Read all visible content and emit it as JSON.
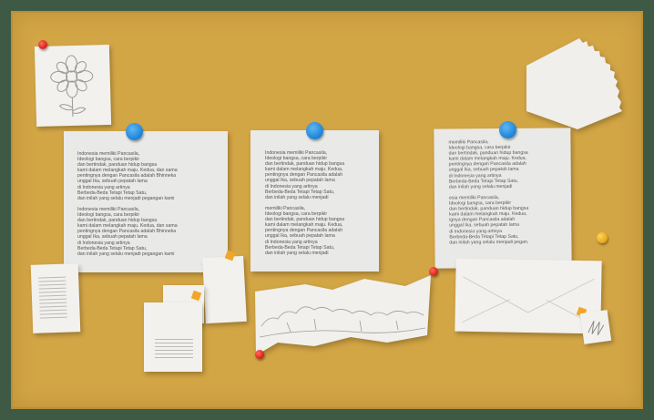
{
  "notes": {
    "left": "Indonesia memiliki Pancasila,\nIdeologi bangsa, cara berpikir\ndan bertindak, panduan hidup bangsa\nkami dalam melangkah maju. Kedua, dan sama\npentingnya dengan Pancasila adalah Bhinneka\nunggal Ika, sebuah pepatah lama\ndi Indonesia yang artinya\nBerbeda-Beda Tetapi Tetap Satu,\ndan inilah yang selalu menjadi pegangan kami\n\nIndonesia memiliki Pancasila,\nIdeologi bangsa, cara berpikir\ndan bertindak, panduan hidup bangsa\nkami dalam melangkah maju. Kedua, dan sama\npentingnya dengan Pancasila adalah Bhinneka\nunggal Ika, sebuah pepatah lama\ndi Indonesia yang artinya\nBerbeda-Beda Tetapi Tetap Satu,\ndan inilah yang selalu menjadi pegangan kami",
    "middle": "Indonesia memiliki Pancasila,\nIdeologi bangsa, cara berpikir\ndan bertindak, panduan hidup bangsa\nkami dalam melangkah maju. Kedua,\npentingnya dengan Pancasila adalah\nunggal Ika, sebuah pepatah lama\ndi Indonesia yang artinya\nBerbeda-Beda Tetapi Tetap Satu,\ndan inilah yang selalu menjadi\n\nmemiliki Pancasila,\nIdeologi bangsa, cara berpikir\ndan bertindak, panduan hidup bangsa\nkami dalam melangkah maju. Kedua,\npentingnya dengan Pancasila adalah\nunggal Ika, sebuah pepatah lama\ndi Indonesia yang artinya\nBerbeda-Beda Tetapi Tetap Satu,\ndan inilah yang selalu menjadi",
    "right": "memiliki Pancasila,\nIdeologi bangsa, cara berpikir\ndan bertindak, panduan hidup bangsa\nkami dalam melangkah maju. Kedua,\npentingnya dengan Pancasila adalah\nunggal Ika, sebuah pepatah lama\ndi Indonesia yang artinya\nBerbeda-Beda Tetapi Tetap Satu,\ndan inilah yang selalu menjadi\n\nesia memiliki Pancasila,\nIdeologi bangsa, cara berpikir\ndan bertindak, panduan hidup bangsa\nkami dalam melangkah maju. Kedua,\nignya dengan Pancasila adalah\nunggal Ika, sebuah pepatah lama\ndi Indonesia yang artinya\nBerbeda-Beda Tetapi Tetap Satu,\ndan inilah yang selalu menjadi pegan,"
  },
  "icons": {
    "flower": "flower-sketch-icon",
    "landscape": "landscape-sketch-icon"
  },
  "colors": {
    "board": "#d2a545",
    "frame": "#3e5944",
    "pin_blue": "#1f86d8",
    "pin_red": "#d81d16",
    "pin_yellow": "#e6a51b"
  }
}
